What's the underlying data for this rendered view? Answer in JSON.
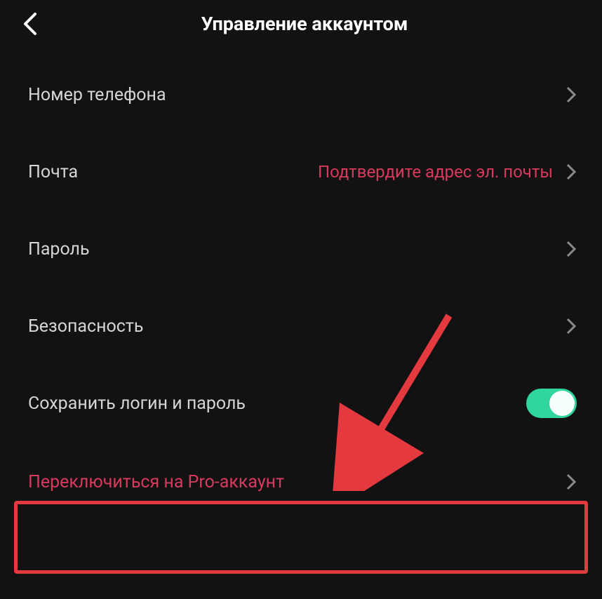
{
  "header": {
    "title": "Управление аккаунтом"
  },
  "rows": {
    "phone": {
      "label": "Номер телефона"
    },
    "email": {
      "label": "Почта",
      "value": "Подтвердите адрес эл. почты"
    },
    "password": {
      "label": "Пароль"
    },
    "security": {
      "label": "Безопасность"
    },
    "saveLogin": {
      "label": "Сохранить логин и пароль",
      "toggle": true
    },
    "pro": {
      "label": "Переключиться на Pro-аккаунт"
    }
  },
  "colors": {
    "accent": "#d83a5e",
    "toggleOn": "#30d69b",
    "annotation": "#e53940"
  }
}
